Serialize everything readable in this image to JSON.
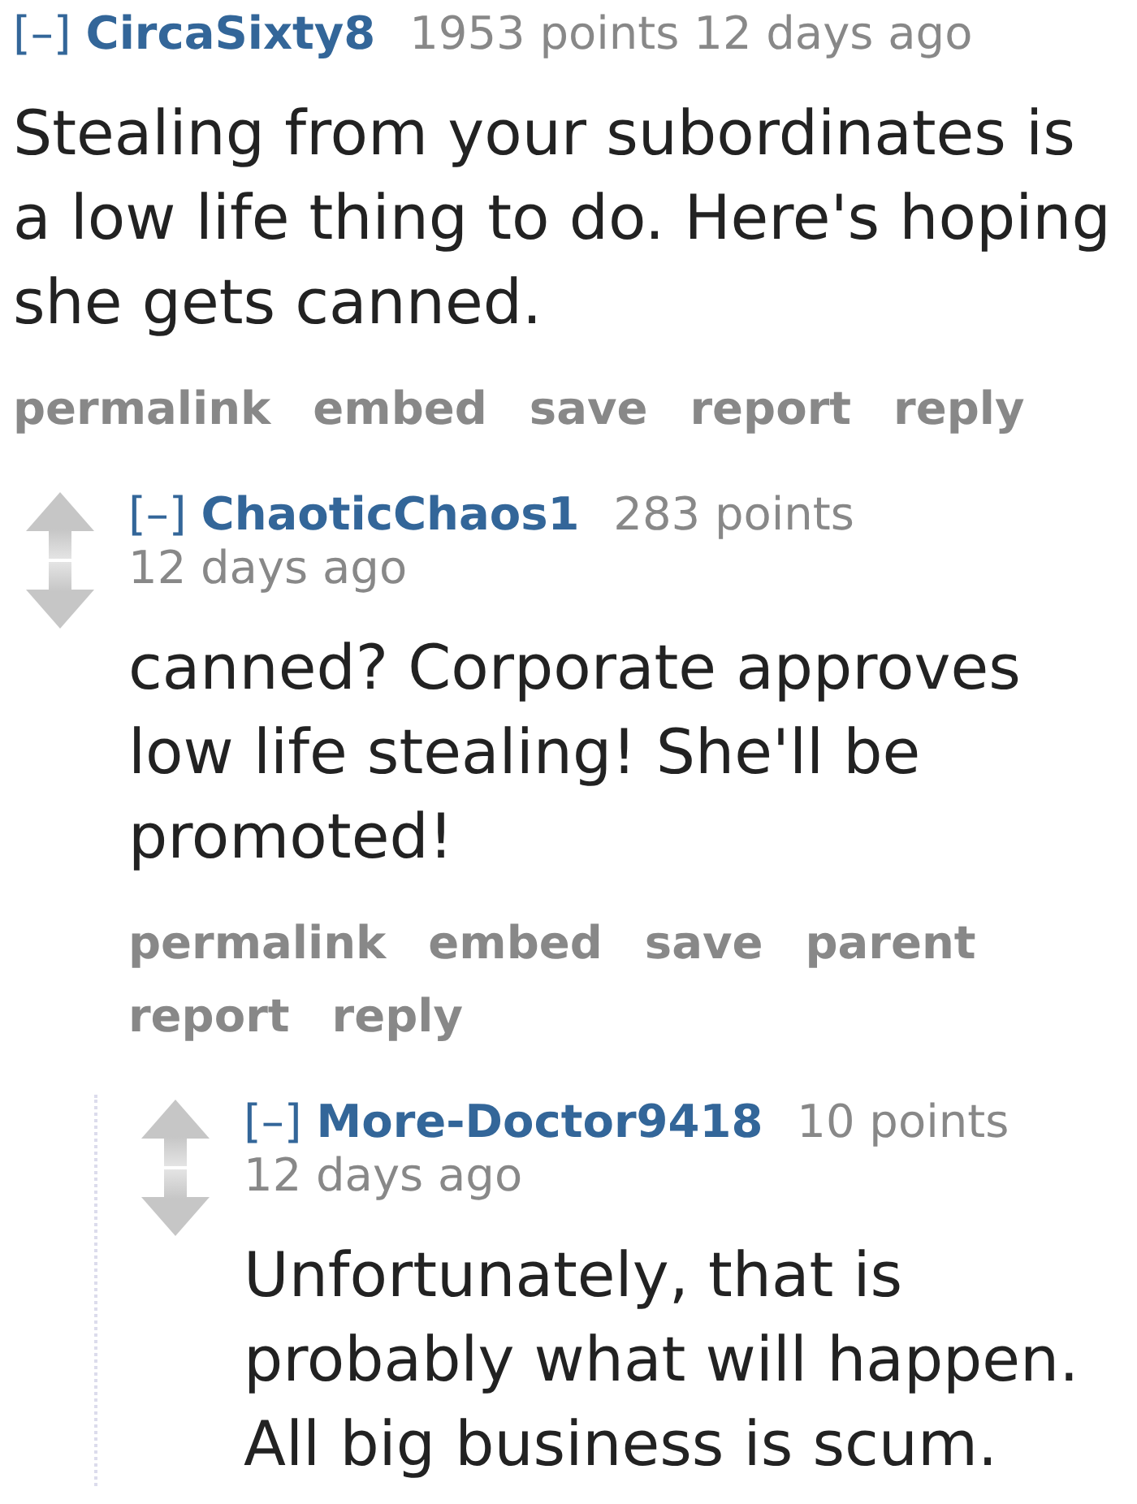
{
  "comments": [
    {
      "collapse": "[–]",
      "author": "CircaSixty8",
      "score": "1953 points",
      "time": "12 days ago",
      "body": "Stealing from your subordinates is a low life thing to do. Here's hoping she gets canned.",
      "actions": [
        "permalink",
        "embed",
        "save",
        "report",
        "reply"
      ],
      "children": [
        {
          "collapse": "[–]",
          "author": "ChaoticChaos1",
          "score": "283 points",
          "time": "12 days ago",
          "body": "canned? Corporate approves low life stealing! She'll be promoted!",
          "actions": [
            "permalink",
            "embed",
            "save",
            "parent",
            "report",
            "reply"
          ],
          "children": [
            {
              "collapse": "[–]",
              "author": "More-Doctor9418",
              "score": "10 points",
              "time": "12 days ago",
              "body": "Unfortunately, that is probably what will happen. All big business is scum."
            }
          ]
        }
      ]
    }
  ]
}
